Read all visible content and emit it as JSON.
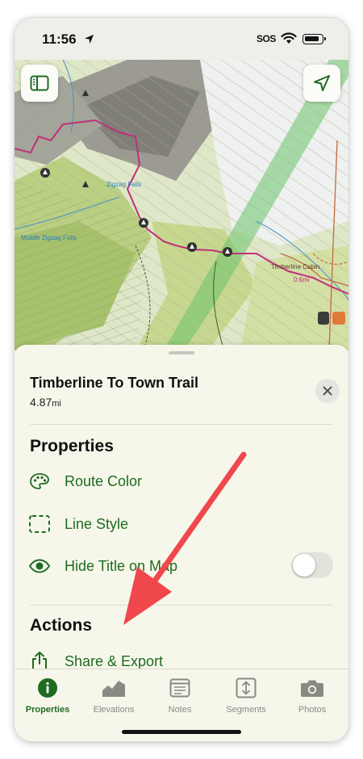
{
  "status_bar": {
    "time": "11:56",
    "sos": "SOS"
  },
  "map": {
    "labels": {
      "zigzag_falls": "Zigzag Falls",
      "middle_zigzag_falls": "Middle Zigzag Falls",
      "timberline_cabin": "Timberline Cabin",
      "distance_mark": "0.6mi"
    },
    "sidebar_button_icon": "sidebar-icon",
    "locate_button_icon": "location-arrow-icon"
  },
  "sheet": {
    "route_title": "Timberline To Town Trail",
    "distance_value": "4.87",
    "distance_unit": "mi",
    "properties_header": "Properties",
    "route_color_label": "Route Color",
    "line_style_label": "Line Style",
    "hide_title_label": "Hide Title on Map",
    "hide_title_on": false,
    "actions_header": "Actions",
    "share_export_label": "Share & Export"
  },
  "tabs": [
    {
      "label": "Properties",
      "icon": "info-icon",
      "active": true
    },
    {
      "label": "Elevations",
      "icon": "elevation-icon",
      "active": false
    },
    {
      "label": "Notes",
      "icon": "notes-icon",
      "active": false
    },
    {
      "label": "Segments",
      "icon": "segments-icon",
      "active": false
    },
    {
      "label": "Photos",
      "icon": "camera-icon",
      "active": false
    }
  ],
  "colors": {
    "accent_green": "#1f6b22",
    "annotation_arrow": "#f0474d",
    "route_line": "#c0307a"
  }
}
